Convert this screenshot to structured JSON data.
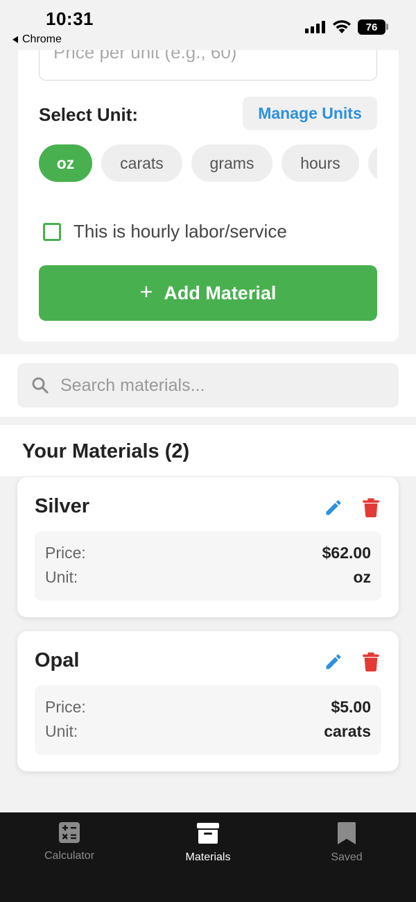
{
  "status_bar": {
    "time": "10:31",
    "back_app": "Chrome",
    "battery": "76"
  },
  "form": {
    "price_placeholder": "Price per unit (e.g., 60)",
    "select_unit_label": "Select Unit:",
    "manage_units_label": "Manage Units",
    "units": [
      "oz",
      "carats",
      "grams",
      "hours",
      ""
    ],
    "selected_unit": "oz",
    "hourly_label": "This is hourly labor/service",
    "hourly_checked": false,
    "add_button_label": "Add Material"
  },
  "search": {
    "placeholder": "Search materials..."
  },
  "materials_section": {
    "title": "Your Materials (2)"
  },
  "materials": [
    {
      "name": "Silver",
      "price_label": "Price:",
      "price": "$62.00",
      "unit_label": "Unit:",
      "unit": "oz"
    },
    {
      "name": "Opal",
      "price_label": "Price:",
      "price": "$5.00",
      "unit_label": "Unit:",
      "unit": "carats"
    }
  ],
  "nav": {
    "items": [
      {
        "label": "Calculator",
        "icon": "calculator-icon",
        "active": false
      },
      {
        "label": "Materials",
        "icon": "archive-box-icon",
        "active": true
      },
      {
        "label": "Saved",
        "icon": "bookmark-icon",
        "active": false
      }
    ]
  },
  "colors": {
    "accent_green": "#49b04f",
    "link_blue": "#2e90de",
    "delete_red": "#e53935",
    "nav_bg": "#151515"
  }
}
